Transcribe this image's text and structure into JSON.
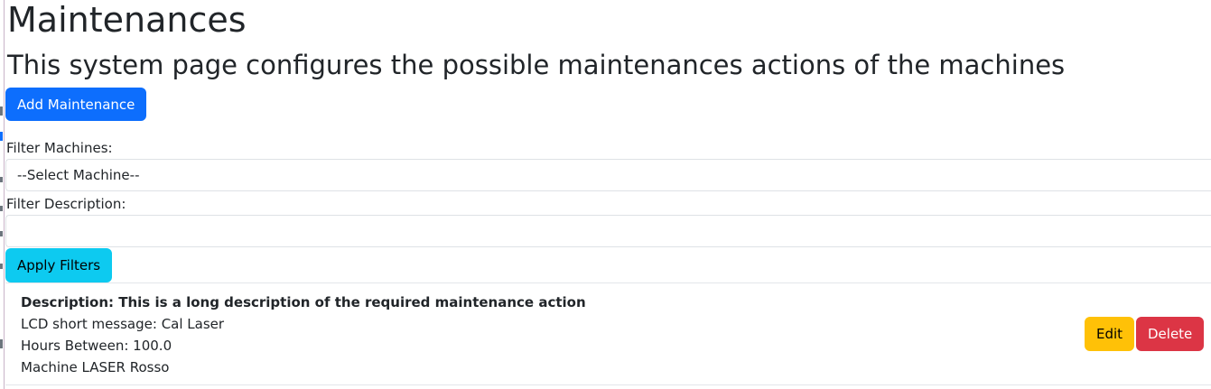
{
  "page": {
    "title": "Maintenances",
    "subtitle": "This system page configures the possible maintenances actions of the machines"
  },
  "actions": {
    "add_label": "Add Maintenance"
  },
  "filters": {
    "machine_label": "Filter Machines:",
    "machine_selected": "--Select Machine--",
    "description_label": "Filter Description:",
    "description_value": "",
    "apply_label": "Apply Filters"
  },
  "maintenances": [
    {
      "description": "Description: This is a long description of the required maintenance action",
      "lcd_message": "LCD short message: Cal Laser",
      "hours_between": "Hours Between: 100.0",
      "machine": "Machine LASER Rosso",
      "edit_label": "Edit",
      "delete_label": "Delete"
    }
  ],
  "colors": {
    "primary": "#0d6efd",
    "info": "#0dcaf0",
    "warning": "#ffc107",
    "danger": "#dc3545"
  }
}
